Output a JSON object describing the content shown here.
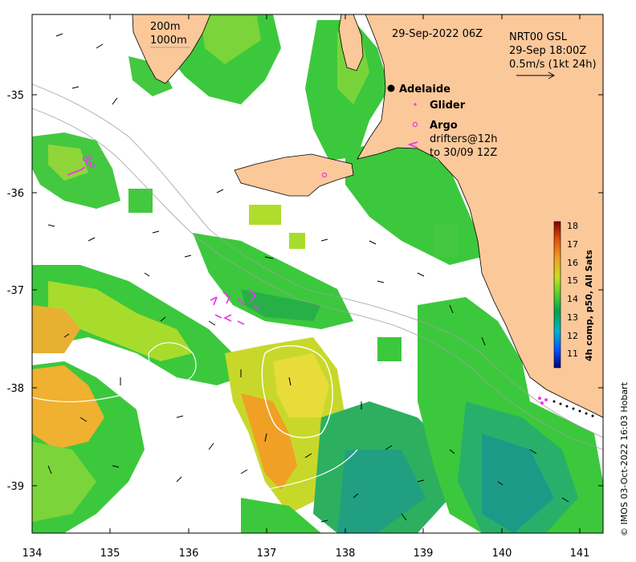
{
  "map": {
    "date_label": "29-Sep-2022 06Z",
    "bathy_labels": [
      "200m",
      "1000m"
    ],
    "current_title": "NRT00 GSL",
    "current_time": "29-Sep 18:00Z",
    "current_scale": "0.5m/s (1kt 24h)",
    "credit": "© IMOS 03-Oct-2022 16:03 Hobart",
    "lon_min": 134,
    "lon_max": 141.3,
    "lat_min": -39.45,
    "lat_max": -34.2
  },
  "legend": {
    "adelaide": "Adelaide",
    "glider": "Glider",
    "argo": "Argo",
    "drifters_line1": "drifters@12h",
    "drifters_line2": "to 30/09 12Z"
  },
  "x_ticks": [
    "134",
    "135",
    "136",
    "137",
    "138",
    "139",
    "140",
    "141"
  ],
  "y_ticks": [
    "-35",
    "-36",
    "-37",
    "-38",
    "-39"
  ],
  "colorbar": {
    "title": "4h comp, p50, All Sats",
    "ticks": [
      "11",
      "12",
      "13",
      "14",
      "15",
      "16",
      "17",
      "18"
    ],
    "min": 10.5,
    "max": 18.5
  },
  "colors": {
    "land": "#fbc89a",
    "sst_green": "#3cc83c",
    "sst_lime": "#b4dc28",
    "sst_orange": "#f2a025",
    "glider": "#e83ce8"
  }
}
